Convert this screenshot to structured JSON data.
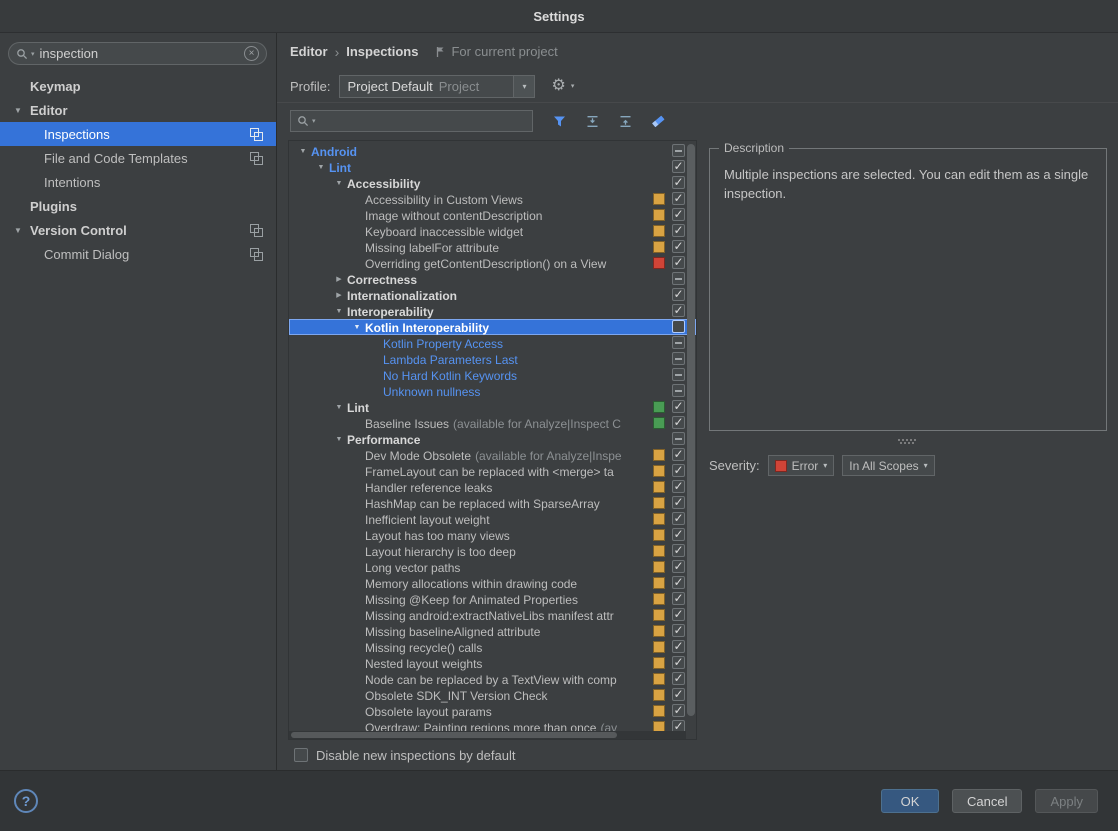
{
  "colors": {
    "accent": "#3573d9",
    "warning": "#d9a343",
    "error": "#d04437",
    "success": "#499c54",
    "link": "#5693f2"
  },
  "icons": {
    "collapse-arrow": "▼",
    "expand-arrow": "▶",
    "dropdown-arrow": "▾",
    "gear": "⚙",
    "clear": "×",
    "check": "✓",
    "help": "?",
    "breadcrumb-separator": "›"
  },
  "window": {
    "title": "Settings"
  },
  "sidebar": {
    "search": {
      "value": "inspection"
    },
    "items": [
      {
        "label": "Keymap",
        "level": 0,
        "bold": true
      },
      {
        "label": "Editor",
        "level": 0,
        "bold": true,
        "arrow": true
      },
      {
        "label": "Inspections",
        "level": 1,
        "selected": true,
        "icon": true
      },
      {
        "label": "File and Code Templates",
        "level": 1,
        "icon": true
      },
      {
        "label": "Intentions",
        "level": 1
      },
      {
        "label": "Plugins",
        "level": 0,
        "bold": true
      },
      {
        "label": "Version Control",
        "level": 0,
        "bold": true,
        "arrow": true,
        "icon": true
      },
      {
        "label": "Commit Dialog",
        "level": 1,
        "icon": true
      }
    ]
  },
  "header": {
    "breadcrumb": {
      "part1": "Editor",
      "part2": "Inspections",
      "scope_note": "For current project"
    },
    "profile": {
      "label": "Profile:",
      "value": "Project Default",
      "hint": "Project"
    }
  },
  "inspections": {
    "search": {
      "value": ""
    },
    "rows": [
      {
        "label": "Android",
        "level": 0,
        "style": "group-link",
        "arrow": "down",
        "check": "dash"
      },
      {
        "label": "Lint",
        "level": 1,
        "style": "group-link",
        "arrow": "down",
        "check": "checked"
      },
      {
        "label": "Accessibility",
        "level": 2,
        "style": "group",
        "arrow": "down",
        "check": "checked"
      },
      {
        "label": "Accessibility in Custom Views",
        "level": 3,
        "style": "normal",
        "badge": "warning",
        "check": "checked"
      },
      {
        "label": "Image without contentDescription",
        "level": 3,
        "style": "normal",
        "badge": "warning",
        "check": "checked"
      },
      {
        "label": "Keyboard inaccessible widget",
        "level": 3,
        "style": "normal",
        "badge": "warning",
        "check": "checked"
      },
      {
        "label": "Missing labelFor attribute",
        "level": 3,
        "style": "normal",
        "badge": "warning",
        "check": "checked"
      },
      {
        "label": "Overriding getContentDescription() on a View",
        "level": 3,
        "style": "normal",
        "badge": "error",
        "check": "checked"
      },
      {
        "label": "Correctness",
        "level": 2,
        "style": "group",
        "arrow": "right",
        "check": "dash"
      },
      {
        "label": "Internationalization",
        "level": 2,
        "style": "group",
        "arrow": "right",
        "check": "checked"
      },
      {
        "label": "Interoperability",
        "level": 2,
        "style": "group",
        "arrow": "down",
        "check": "checked"
      },
      {
        "label": "Kotlin Interoperability",
        "level": 3,
        "style": "group",
        "arrow": "down",
        "check": "empty",
        "selected": true
      },
      {
        "label": "Kotlin Property Access",
        "level": 4,
        "style": "link",
        "check": "dash"
      },
      {
        "label": "Lambda Parameters Last",
        "level": 4,
        "style": "link",
        "check": "dash"
      },
      {
        "label": "No Hard Kotlin Keywords",
        "level": 4,
        "style": "link",
        "check": "dash"
      },
      {
        "label": "Unknown nullness",
        "level": 4,
        "style": "link",
        "check": "dash"
      },
      {
        "label": "Lint",
        "level": 2,
        "style": "group",
        "arrow": "down",
        "badge": "success",
        "check": "checked"
      },
      {
        "label": "Baseline Issues",
        "suffix": "(available for Analyze|Inspect C",
        "level": 3,
        "style": "normal",
        "badge": "success",
        "check": "checked"
      },
      {
        "label": "Performance",
        "level": 2,
        "style": "group",
        "arrow": "down",
        "check": "dash"
      },
      {
        "label": "Dev Mode Obsolete",
        "suffix": "(available for Analyze|Inspe",
        "level": 3,
        "style": "normal",
        "badge": "warning",
        "check": "checked"
      },
      {
        "label": "FrameLayout can be replaced with <merge> ta",
        "level": 3,
        "style": "normal",
        "badge": "warning",
        "check": "checked"
      },
      {
        "label": "Handler reference leaks",
        "level": 3,
        "style": "normal",
        "badge": "warning",
        "check": "checked"
      },
      {
        "label": "HashMap can be replaced with SparseArray",
        "level": 3,
        "style": "normal",
        "badge": "warning",
        "check": "checked"
      },
      {
        "label": "Inefficient layout weight",
        "level": 3,
        "style": "normal",
        "badge": "warning",
        "check": "checked"
      },
      {
        "label": "Layout has too many views",
        "level": 3,
        "style": "normal",
        "badge": "warning",
        "check": "checked"
      },
      {
        "label": "Layout hierarchy is too deep",
        "level": 3,
        "style": "normal",
        "badge": "warning",
        "check": "checked"
      },
      {
        "label": "Long vector paths",
        "level": 3,
        "style": "normal",
        "badge": "warning",
        "check": "checked"
      },
      {
        "label": "Memory allocations within drawing code",
        "level": 3,
        "style": "normal",
        "badge": "warning",
        "check": "checked"
      },
      {
        "label": "Missing @Keep for Animated Properties",
        "level": 3,
        "style": "normal",
        "badge": "warning",
        "check": "checked"
      },
      {
        "label": "Missing android:extractNativeLibs manifest attr",
        "level": 3,
        "style": "normal",
        "badge": "warning",
        "check": "checked"
      },
      {
        "label": "Missing baselineAligned attribute",
        "level": 3,
        "style": "normal",
        "badge": "warning",
        "check": "checked"
      },
      {
        "label": "Missing recycle() calls",
        "level": 3,
        "style": "normal",
        "badge": "warning",
        "check": "checked"
      },
      {
        "label": "Nested layout weights",
        "level": 3,
        "style": "normal",
        "badge": "warning",
        "check": "checked"
      },
      {
        "label": "Node can be replaced by a TextView with comp",
        "level": 3,
        "style": "normal",
        "badge": "warning",
        "check": "checked"
      },
      {
        "label": "Obsolete SDK_INT Version Check",
        "level": 3,
        "style": "normal",
        "badge": "warning",
        "check": "checked"
      },
      {
        "label": "Obsolete layout params",
        "level": 3,
        "style": "normal",
        "badge": "warning",
        "check": "checked"
      },
      {
        "label": "Overdraw: Painting regions more than once",
        "suffix": "(av",
        "level": 3,
        "style": "normal",
        "badge": "warning",
        "check": "checked"
      }
    ]
  },
  "description": {
    "title": "Description",
    "text": "Multiple inspections are selected. You can edit them as a single inspection."
  },
  "severity": {
    "label": "Severity:",
    "value": "Error",
    "scope_value": "In All Scopes"
  },
  "options": {
    "disable_new": "Disable new inspections by default"
  },
  "footer": {
    "ok": "OK",
    "cancel": "Cancel",
    "apply": "Apply"
  }
}
